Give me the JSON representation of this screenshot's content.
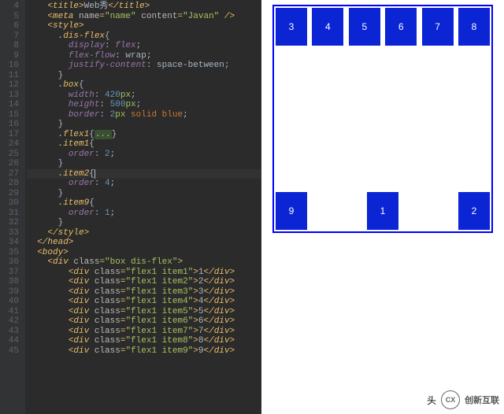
{
  "editor": {
    "line_start": 4,
    "selected_line": 27,
    "lines": [
      {
        "n": 4,
        "ind": 2,
        "seg": [
          {
            "c": "tag",
            "t": "<title>"
          },
          {
            "c": "plain",
            "t": "Web秀"
          },
          {
            "c": "tag",
            "t": "</title>"
          }
        ]
      },
      {
        "n": 5,
        "ind": 2,
        "seg": [
          {
            "c": "tag",
            "t": "<meta "
          },
          {
            "c": "attr",
            "t": "name"
          },
          {
            "c": "tag",
            "t": "="
          },
          {
            "c": "val",
            "t": "\"name\""
          },
          {
            "c": "tag",
            "t": " "
          },
          {
            "c": "attr",
            "t": "content"
          },
          {
            "c": "tag",
            "t": "="
          },
          {
            "c": "val",
            "t": "\"Javan\""
          },
          {
            "c": "tag",
            "t": " />"
          }
        ]
      },
      {
        "n": 6,
        "ind": 2,
        "seg": [
          {
            "c": "tag",
            "t": "<style>"
          }
        ]
      },
      {
        "n": 7,
        "ind": 3,
        "seg": [
          {
            "c": "sel",
            "t": ".dis-flex"
          },
          {
            "c": "brace",
            "t": "{"
          }
        ]
      },
      {
        "n": 8,
        "ind": 4,
        "seg": [
          {
            "c": "prop",
            "t": "display"
          },
          {
            "c": "plain",
            "t": ": "
          },
          {
            "c": "prop",
            "t": "flex"
          },
          {
            "c": "plain",
            "t": ";"
          }
        ]
      },
      {
        "n": 9,
        "ind": 4,
        "seg": [
          {
            "c": "prop",
            "t": "flex-flow"
          },
          {
            "c": "plain",
            "t": ": wrap;"
          }
        ]
      },
      {
        "n": 10,
        "ind": 4,
        "seg": [
          {
            "c": "prop",
            "t": "justify-content"
          },
          {
            "c": "plain",
            "t": ": space-between;"
          }
        ]
      },
      {
        "n": 11,
        "ind": 3,
        "seg": [
          {
            "c": "brace",
            "t": "}"
          }
        ]
      },
      {
        "n": 12,
        "ind": 3,
        "seg": [
          {
            "c": "sel",
            "t": ".box"
          },
          {
            "c": "brace",
            "t": "{"
          }
        ]
      },
      {
        "n": 13,
        "ind": 4,
        "seg": [
          {
            "c": "prop",
            "t": "width"
          },
          {
            "c": "plain",
            "t": ": "
          },
          {
            "c": "num",
            "t": "420"
          },
          {
            "c": "unit",
            "t": "px"
          },
          {
            "c": "plain",
            "t": ";"
          }
        ]
      },
      {
        "n": 14,
        "ind": 4,
        "seg": [
          {
            "c": "prop",
            "t": "height"
          },
          {
            "c": "plain",
            "t": ": "
          },
          {
            "c": "num",
            "t": "500"
          },
          {
            "c": "unit",
            "t": "px"
          },
          {
            "c": "plain",
            "t": ";"
          }
        ]
      },
      {
        "n": 15,
        "ind": 4,
        "seg": [
          {
            "c": "prop",
            "t": "border"
          },
          {
            "c": "plain",
            "t": ": "
          },
          {
            "c": "num",
            "t": "2"
          },
          {
            "c": "unit",
            "t": "px"
          },
          {
            "c": "plain",
            "t": " "
          },
          {
            "c": "kw",
            "t": "solid"
          },
          {
            "c": "plain",
            "t": " "
          },
          {
            "c": "kw",
            "t": "blue"
          },
          {
            "c": "plain",
            "t": ";"
          }
        ]
      },
      {
        "n": 16,
        "ind": 3,
        "seg": [
          {
            "c": "brace",
            "t": "}"
          }
        ]
      },
      {
        "n": 17,
        "ind": 3,
        "seg": [
          {
            "c": "sel",
            "t": ".flex1"
          },
          {
            "c": "brace",
            "t": "{"
          },
          {
            "c": "fold",
            "t": "..."
          },
          {
            "c": "brace",
            "t": "}"
          }
        ]
      },
      {
        "n": 24,
        "ind": 3,
        "seg": [
          {
            "c": "sel",
            "t": ".item1"
          },
          {
            "c": "brace",
            "t": "{"
          }
        ]
      },
      {
        "n": 25,
        "ind": 4,
        "seg": [
          {
            "c": "prop",
            "t": "order"
          },
          {
            "c": "plain",
            "t": ": "
          },
          {
            "c": "num",
            "t": "2"
          },
          {
            "c": "plain",
            "t": ";"
          }
        ]
      },
      {
        "n": 26,
        "ind": 3,
        "seg": [
          {
            "c": "brace",
            "t": "}"
          }
        ]
      },
      {
        "n": 27,
        "ind": 3,
        "hl": true,
        "seg": [
          {
            "c": "sel",
            "t": ".item2"
          },
          {
            "c": "brace",
            "t": "{"
          },
          {
            "c": "caret",
            "t": ""
          }
        ]
      },
      {
        "n": 28,
        "ind": 4,
        "seg": [
          {
            "c": "prop",
            "t": "order"
          },
          {
            "c": "plain",
            "t": ": "
          },
          {
            "c": "num",
            "t": "4"
          },
          {
            "c": "plain",
            "t": ";"
          }
        ]
      },
      {
        "n": 29,
        "ind": 3,
        "seg": [
          {
            "c": "brace",
            "t": "}"
          }
        ]
      },
      {
        "n": 30,
        "ind": 3,
        "seg": [
          {
            "c": "sel",
            "t": ".item9"
          },
          {
            "c": "brace",
            "t": "{"
          }
        ]
      },
      {
        "n": 31,
        "ind": 4,
        "seg": [
          {
            "c": "prop",
            "t": "order"
          },
          {
            "c": "plain",
            "t": ": "
          },
          {
            "c": "num",
            "t": "1"
          },
          {
            "c": "plain",
            "t": ";"
          }
        ]
      },
      {
        "n": 32,
        "ind": 3,
        "seg": [
          {
            "c": "brace",
            "t": "}"
          }
        ]
      },
      {
        "n": 33,
        "ind": 2,
        "seg": [
          {
            "c": "tag",
            "t": "</style>"
          }
        ]
      },
      {
        "n": 34,
        "ind": 1,
        "seg": [
          {
            "c": "tag",
            "t": "</head>"
          }
        ]
      },
      {
        "n": 35,
        "ind": 1,
        "seg": [
          {
            "c": "tag",
            "t": "<body>"
          }
        ]
      },
      {
        "n": 36,
        "ind": 2,
        "seg": [
          {
            "c": "tag",
            "t": "<div "
          },
          {
            "c": "attr",
            "t": "class"
          },
          {
            "c": "tag",
            "t": "="
          },
          {
            "c": "val",
            "t": "\"box dis-flex\""
          },
          {
            "c": "tag",
            "t": ">"
          }
        ]
      },
      {
        "n": 37,
        "ind": 4,
        "seg": [
          {
            "c": "tag",
            "t": "<div "
          },
          {
            "c": "attr",
            "t": "class"
          },
          {
            "c": "tag",
            "t": "="
          },
          {
            "c": "val",
            "t": "\"flex1 item1\""
          },
          {
            "c": "tag",
            "t": ">"
          },
          {
            "c": "plain",
            "t": "1"
          },
          {
            "c": "tag",
            "t": "</div>"
          }
        ]
      },
      {
        "n": 38,
        "ind": 4,
        "seg": [
          {
            "c": "tag",
            "t": "<div "
          },
          {
            "c": "attr",
            "t": "class"
          },
          {
            "c": "tag",
            "t": "="
          },
          {
            "c": "val",
            "t": "\"flex1 item2\""
          },
          {
            "c": "tag",
            "t": ">"
          },
          {
            "c": "plain",
            "t": "2"
          },
          {
            "c": "tag",
            "t": "</div>"
          }
        ]
      },
      {
        "n": 39,
        "ind": 4,
        "seg": [
          {
            "c": "tag",
            "t": "<div "
          },
          {
            "c": "attr",
            "t": "class"
          },
          {
            "c": "tag",
            "t": "="
          },
          {
            "c": "val",
            "t": "\"flex1 item3\""
          },
          {
            "c": "tag",
            "t": ">"
          },
          {
            "c": "plain",
            "t": "3"
          },
          {
            "c": "tag",
            "t": "</div>"
          }
        ]
      },
      {
        "n": 40,
        "ind": 4,
        "seg": [
          {
            "c": "tag",
            "t": "<div "
          },
          {
            "c": "attr",
            "t": "class"
          },
          {
            "c": "tag",
            "t": "="
          },
          {
            "c": "val",
            "t": "\"flex1 item4\""
          },
          {
            "c": "tag",
            "t": ">"
          },
          {
            "c": "plain",
            "t": "4"
          },
          {
            "c": "tag",
            "t": "</div>"
          }
        ]
      },
      {
        "n": 41,
        "ind": 4,
        "seg": [
          {
            "c": "tag",
            "t": "<div "
          },
          {
            "c": "attr",
            "t": "class"
          },
          {
            "c": "tag",
            "t": "="
          },
          {
            "c": "val",
            "t": "\"flex1 item5\""
          },
          {
            "c": "tag",
            "t": ">"
          },
          {
            "c": "plain",
            "t": "5"
          },
          {
            "c": "tag",
            "t": "</div>"
          }
        ]
      },
      {
        "n": 42,
        "ind": 4,
        "seg": [
          {
            "c": "tag",
            "t": "<div "
          },
          {
            "c": "attr",
            "t": "class"
          },
          {
            "c": "tag",
            "t": "="
          },
          {
            "c": "val",
            "t": "\"flex1 item6\""
          },
          {
            "c": "tag",
            "t": ">"
          },
          {
            "c": "plain",
            "t": "6"
          },
          {
            "c": "tag",
            "t": "</div>"
          }
        ]
      },
      {
        "n": 43,
        "ind": 4,
        "seg": [
          {
            "c": "tag",
            "t": "<div "
          },
          {
            "c": "attr",
            "t": "class"
          },
          {
            "c": "tag",
            "t": "="
          },
          {
            "c": "val",
            "t": "\"flex1 item7\""
          },
          {
            "c": "tag",
            "t": ">"
          },
          {
            "c": "plain",
            "t": "7"
          },
          {
            "c": "tag",
            "t": "</div>"
          }
        ]
      },
      {
        "n": 44,
        "ind": 4,
        "seg": [
          {
            "c": "tag",
            "t": "<div "
          },
          {
            "c": "attr",
            "t": "class"
          },
          {
            "c": "tag",
            "t": "="
          },
          {
            "c": "val",
            "t": "\"flex1 item8\""
          },
          {
            "c": "tag",
            "t": ">"
          },
          {
            "c": "plain",
            "t": "8"
          },
          {
            "c": "tag",
            "t": "</div>"
          }
        ]
      },
      {
        "n": 45,
        "ind": 4,
        "seg": [
          {
            "c": "tag",
            "t": "<div "
          },
          {
            "c": "attr",
            "t": "class"
          },
          {
            "c": "tag",
            "t": "="
          },
          {
            "c": "val",
            "t": "\"flex1 item9\""
          },
          {
            "c": "tag",
            "t": ">"
          },
          {
            "c": "plain",
            "t": "9"
          },
          {
            "c": "tag",
            "t": "</div>"
          }
        ]
      }
    ]
  },
  "preview": {
    "items": [
      {
        "label": "1",
        "cls": "item1"
      },
      {
        "label": "2",
        "cls": "item2"
      },
      {
        "label": "3",
        "cls": "item3"
      },
      {
        "label": "4",
        "cls": "item4"
      },
      {
        "label": "5",
        "cls": "item5"
      },
      {
        "label": "6",
        "cls": "item6"
      },
      {
        "label": "7",
        "cls": "item7"
      },
      {
        "label": "8",
        "cls": "item8"
      },
      {
        "label": "9",
        "cls": "item9"
      }
    ]
  },
  "watermark": {
    "left": "头",
    "logo": "CX",
    "right": "创新互联"
  }
}
